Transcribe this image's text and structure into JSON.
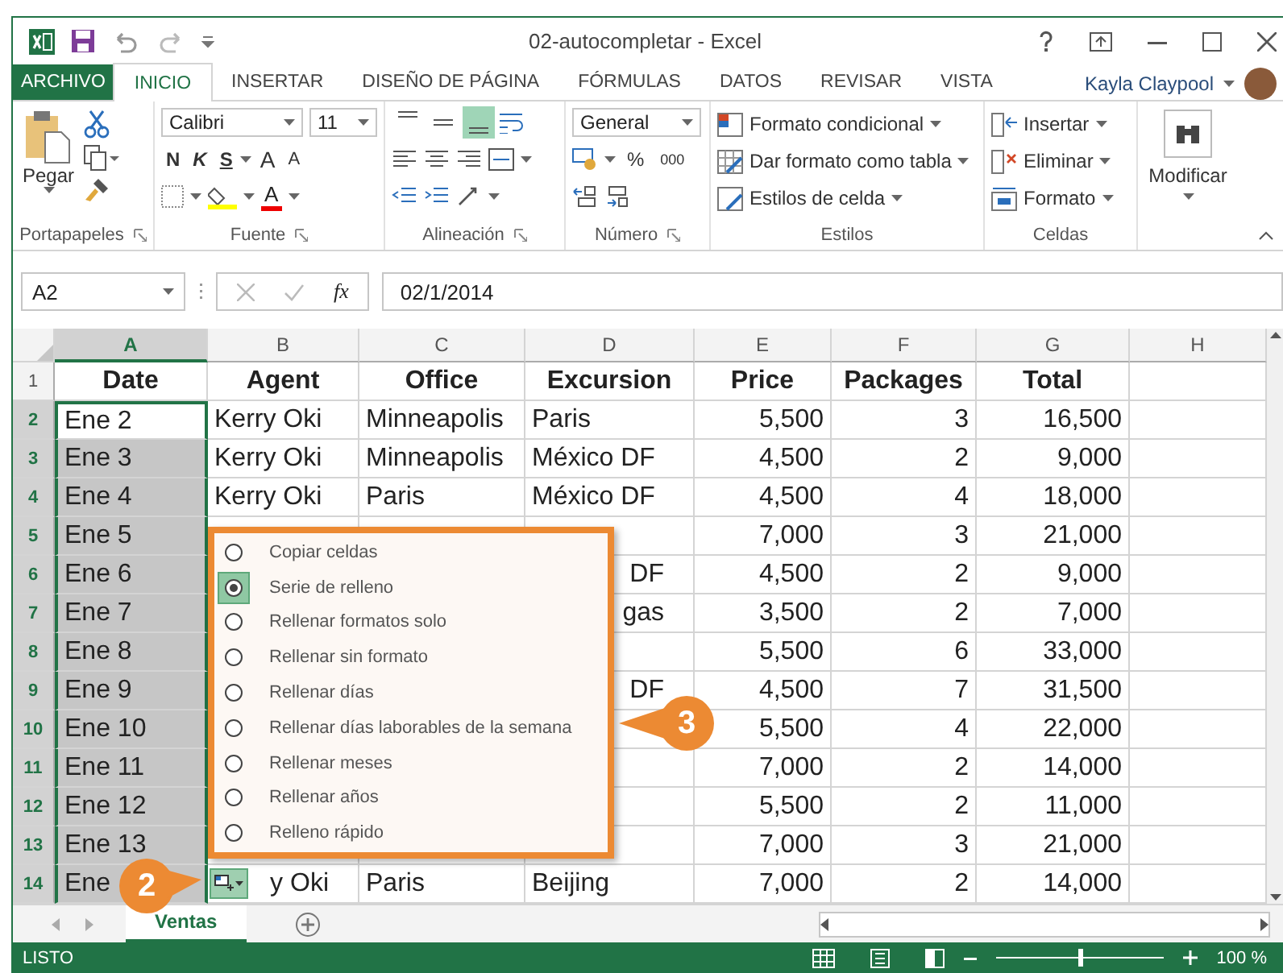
{
  "window": {
    "title": "02-autocompletar - Excel"
  },
  "tabs": [
    {
      "label": "ARCHIVO",
      "kind": "file",
      "selected": false
    },
    {
      "label": "INICIO",
      "kind": "tab",
      "selected": true
    },
    {
      "label": "INSERTAR",
      "kind": "tab",
      "selected": false
    },
    {
      "label": "DISEÑO DE PÁGINA",
      "kind": "tab",
      "selected": false
    },
    {
      "label": "FÓRMULAS",
      "kind": "tab",
      "selected": false
    },
    {
      "label": "DATOS",
      "kind": "tab",
      "selected": false
    },
    {
      "label": "REVISAR",
      "kind": "tab",
      "selected": false
    },
    {
      "label": "VISTA",
      "kind": "tab",
      "selected": false
    }
  ],
  "user": {
    "name": "Kayla Claypool"
  },
  "ribbon": {
    "clipboard": {
      "paste": "Pegar",
      "label": "Portapapeles"
    },
    "font": {
      "family": "Calibri",
      "size": "11",
      "buttons": [
        {
          "label": "N",
          "kind": "bold"
        },
        {
          "label": "K",
          "kind": "italic"
        },
        {
          "label": "S",
          "kind": "underline"
        },
        {
          "label": "A",
          "kind": "grow"
        },
        {
          "label": "A",
          "kind": "shrink"
        }
      ],
      "color_button": "A",
      "label": "Fuente"
    },
    "alignment": {
      "label": "Alineación",
      "vertical": [
        {
          "kind": "top",
          "selected": false
        },
        {
          "kind": "middle",
          "selected": false
        },
        {
          "kind": "bottom",
          "selected": true
        }
      ]
    },
    "number": {
      "format": "General",
      "percent": "%",
      "thousands": "000",
      "label": "Número"
    },
    "styles": {
      "items": [
        "Formato condicional",
        "Dar formato como tabla",
        "Estilos de celda"
      ],
      "label": "Estilos"
    },
    "cells": {
      "items": [
        "Insertar",
        "Eliminar",
        "Formato"
      ],
      "label": "Celdas"
    },
    "editing": {
      "label": "Modificar"
    }
  },
  "formula_bar": {
    "name_box": "A2",
    "fx": "fx",
    "formula": "02/1/2014"
  },
  "grid": {
    "columns": [
      {
        "label": "A",
        "kind": "text",
        "selected": true
      },
      {
        "label": "B",
        "kind": "text",
        "selected": false
      },
      {
        "label": "C",
        "kind": "text",
        "selected": false
      },
      {
        "label": "D",
        "kind": "text",
        "selected": false
      },
      {
        "label": "E",
        "kind": "number",
        "selected": false
      },
      {
        "label": "F",
        "kind": "number",
        "selected": false
      },
      {
        "label": "G",
        "kind": "number",
        "selected": false
      },
      {
        "label": "H",
        "kind": "text",
        "selected": false
      }
    ],
    "rows": [
      {
        "number": "1",
        "kind": "header",
        "selected": false,
        "cells": [
          "Date",
          "Agent",
          "Office",
          "Excursion",
          "Price",
          "Packages",
          "Total"
        ]
      },
      {
        "number": "2",
        "kind": "data",
        "selected": true,
        "cells": [
          {
            "text": "Ene 2",
            "active": true
          },
          "Kerry Oki",
          "Minneapolis",
          "Paris",
          "5,500",
          "3",
          "16,500"
        ]
      },
      {
        "number": "3",
        "kind": "data",
        "selected": true,
        "cells": [
          "Ene 3",
          "Kerry Oki",
          "Minneapolis",
          "México DF",
          "4,500",
          "2",
          "9,000"
        ]
      },
      {
        "number": "4",
        "kind": "data",
        "selected": true,
        "cells": [
          "Ene 4",
          "Kerry Oki",
          "Paris",
          "México DF",
          "4,500",
          "4",
          "18,000"
        ]
      },
      {
        "number": "5",
        "kind": "data",
        "selected": true,
        "cells": [
          "Ene 5",
          null,
          null,
          null,
          "7,000",
          "3",
          "21,000"
        ]
      },
      {
        "number": "6",
        "kind": "data",
        "selected": true,
        "cells": [
          "Ene 6",
          null,
          null,
          {
            "text": "DF",
            "clipped": true
          },
          "4,500",
          "2",
          "9,000"
        ]
      },
      {
        "number": "7",
        "kind": "data",
        "selected": true,
        "cells": [
          "Ene 7",
          null,
          null,
          {
            "text": "gas",
            "clipped": true
          },
          "3,500",
          "2",
          "7,000"
        ]
      },
      {
        "number": "8",
        "kind": "data",
        "selected": true,
        "cells": [
          "Ene 8",
          null,
          null,
          null,
          "5,500",
          "6",
          "33,000"
        ]
      },
      {
        "number": "9",
        "kind": "data",
        "selected": true,
        "cells": [
          "Ene 9",
          null,
          null,
          {
            "text": "DF",
            "clipped": true
          },
          "4,500",
          "7",
          "31,500"
        ]
      },
      {
        "number": "10",
        "kind": "data",
        "selected": true,
        "cells": [
          "Ene 10",
          null,
          null,
          null,
          "5,500",
          "4",
          "22,000"
        ]
      },
      {
        "number": "11",
        "kind": "data",
        "selected": true,
        "cells": [
          "Ene 11",
          null,
          null,
          null,
          "7,000",
          "2",
          "14,000"
        ]
      },
      {
        "number": "12",
        "kind": "data",
        "selected": true,
        "cells": [
          "Ene 12",
          null,
          null,
          null,
          "5,500",
          "2",
          "11,000"
        ]
      },
      {
        "number": "13",
        "kind": "data",
        "selected": true,
        "cells": [
          "Ene 13",
          null,
          null,
          null,
          "7,000",
          "3",
          "21,000"
        ]
      },
      {
        "number": "14",
        "kind": "data",
        "selected": true,
        "cells": [
          "Ene",
          {
            "text": "y Oki",
            "clipped": true
          },
          "Paris",
          "Beijing",
          "7,000",
          "2",
          "14,000"
        ]
      }
    ]
  },
  "fill_menu": {
    "items": [
      {
        "label": "Copiar celdas",
        "selected": false
      },
      {
        "label": "Serie de relleno",
        "selected": true
      },
      {
        "label": "Rellenar formatos solo",
        "selected": false
      },
      {
        "label": "Rellenar sin formato",
        "selected": false
      },
      {
        "label": "Rellenar días",
        "selected": false
      },
      {
        "label": "Rellenar días laborables de la semana",
        "selected": false
      },
      {
        "label": "Rellenar meses",
        "selected": false
      },
      {
        "label": "Rellenar años",
        "selected": false
      },
      {
        "label": "Relleno rápido",
        "selected": false
      }
    ]
  },
  "callouts": [
    {
      "number": "2"
    },
    {
      "number": "3"
    }
  ],
  "sheet_tabs": [
    {
      "label": "Ventas",
      "selected": true
    }
  ],
  "status_bar": {
    "text": "LISTO",
    "zoom": "100 %",
    "zoom_slider": {
      "level": 0.5
    }
  }
}
